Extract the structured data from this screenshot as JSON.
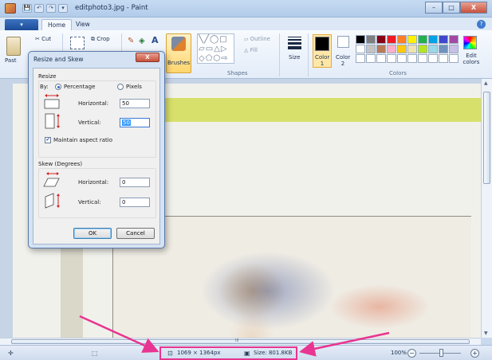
{
  "window": {
    "title": "editphoto3.jpg - Paint",
    "minimize_glyph": "–",
    "maximize_glyph": "□",
    "close_glyph": "X"
  },
  "quick_access": [
    "💾",
    "↶",
    "↷",
    "▾"
  ],
  "tabs": {
    "file_label": "▾",
    "home_label": "Home",
    "view_label": "View",
    "help_glyph": "?"
  },
  "ribbon": {
    "clipboard": {
      "paste_label": "Past",
      "cut_label": "Cut"
    },
    "image": {
      "crop_label": "Crop"
    },
    "tools": {
      "pencil_glyph": "✎",
      "fill_glyph": "◈",
      "text_glyph": "A"
    },
    "brushes_label": "Brushes",
    "shapes": {
      "glyphs": "╲╱◯□ ▱▭△▷ ◇⬠⬡⇨",
      "outline_label": "Outline",
      "fill_label": "Fill",
      "group_label": "Shapes"
    },
    "size_label": "Size",
    "color1_label": "Color 1",
    "color2_label": "Color 2",
    "colors_group_label": "Colors",
    "edit_colors_label": "Edit colors",
    "palette": [
      "#000000",
      "#7f7f7f",
      "#880015",
      "#ed1c24",
      "#ff7f27",
      "#fff200",
      "#22b14c",
      "#00a2e8",
      "#3f48cc",
      "#a349a4",
      "#ffffff",
      "#c3c3c3",
      "#b97a57",
      "#ffaec9",
      "#ffc90e",
      "#efe4b0",
      "#b5e61d",
      "#99d9ea",
      "#7092be",
      "#c8bfe7",
      "#ffffff",
      "#ffffff",
      "#ffffff",
      "#ffffff",
      "#ffffff",
      "#ffffff",
      "#ffffff",
      "#ffffff",
      "#ffffff",
      "#ffffff"
    ]
  },
  "dialog": {
    "title": "Resize and Skew",
    "close_glyph": "X",
    "resize_section": "Resize",
    "by_label": "By:",
    "percentage_label": "Percentage",
    "pixels_label": "Pixels",
    "horizontal_label": "Horizontal:",
    "vertical_label": "Vertical:",
    "resize_horizontal_value": "50",
    "resize_vertical_value": "50",
    "maintain_label": "Maintain aspect ratio",
    "maintain_checked": "✔",
    "skew_section": "Skew (Degrees)",
    "skew_horizontal_value": "0",
    "skew_vertical_value": "0",
    "ok_label": "OK",
    "cancel_label": "Cancel"
  },
  "statusbar": {
    "cursor_icon": "✛",
    "selection_icon": "⬚",
    "dimensions": "1069 × 1364px",
    "size": "Size: 801.8KB",
    "zoom": "100%",
    "zoom_out_glyph": "−",
    "zoom_in_glyph": "+",
    "hscroll_center": "III"
  },
  "accent_colors": {
    "annotation": "#e83591",
    "frame_mat": "#d7e06a"
  }
}
